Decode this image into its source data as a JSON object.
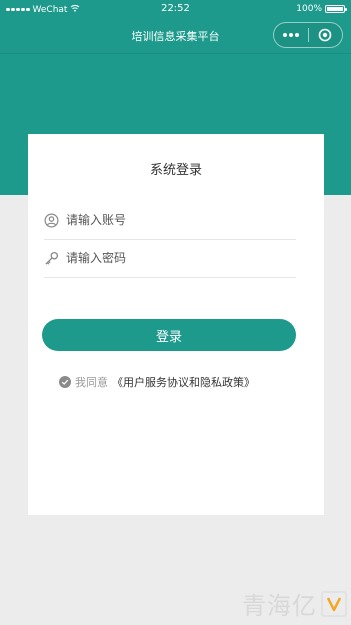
{
  "status_bar": {
    "carrier": "WeChat",
    "time": "22:52",
    "battery": "100%",
    "battery_level": 1.0
  },
  "nav": {
    "title": "培训信息采集平台"
  },
  "login": {
    "title": "系统登录",
    "account_placeholder": "请输入账号",
    "password_placeholder": "请输入密码",
    "submit_label": "登录",
    "agree_prefix": "我同意",
    "agreement_link": "《用户服务协议和隐私政策》"
  },
  "watermark": {
    "text": "青海亿"
  },
  "colors": {
    "primary": "#1d9a8c",
    "background": "#ececec",
    "card": "#ffffff",
    "watermark": "#d8d8d8",
    "logo_accent": "#f5a623"
  }
}
